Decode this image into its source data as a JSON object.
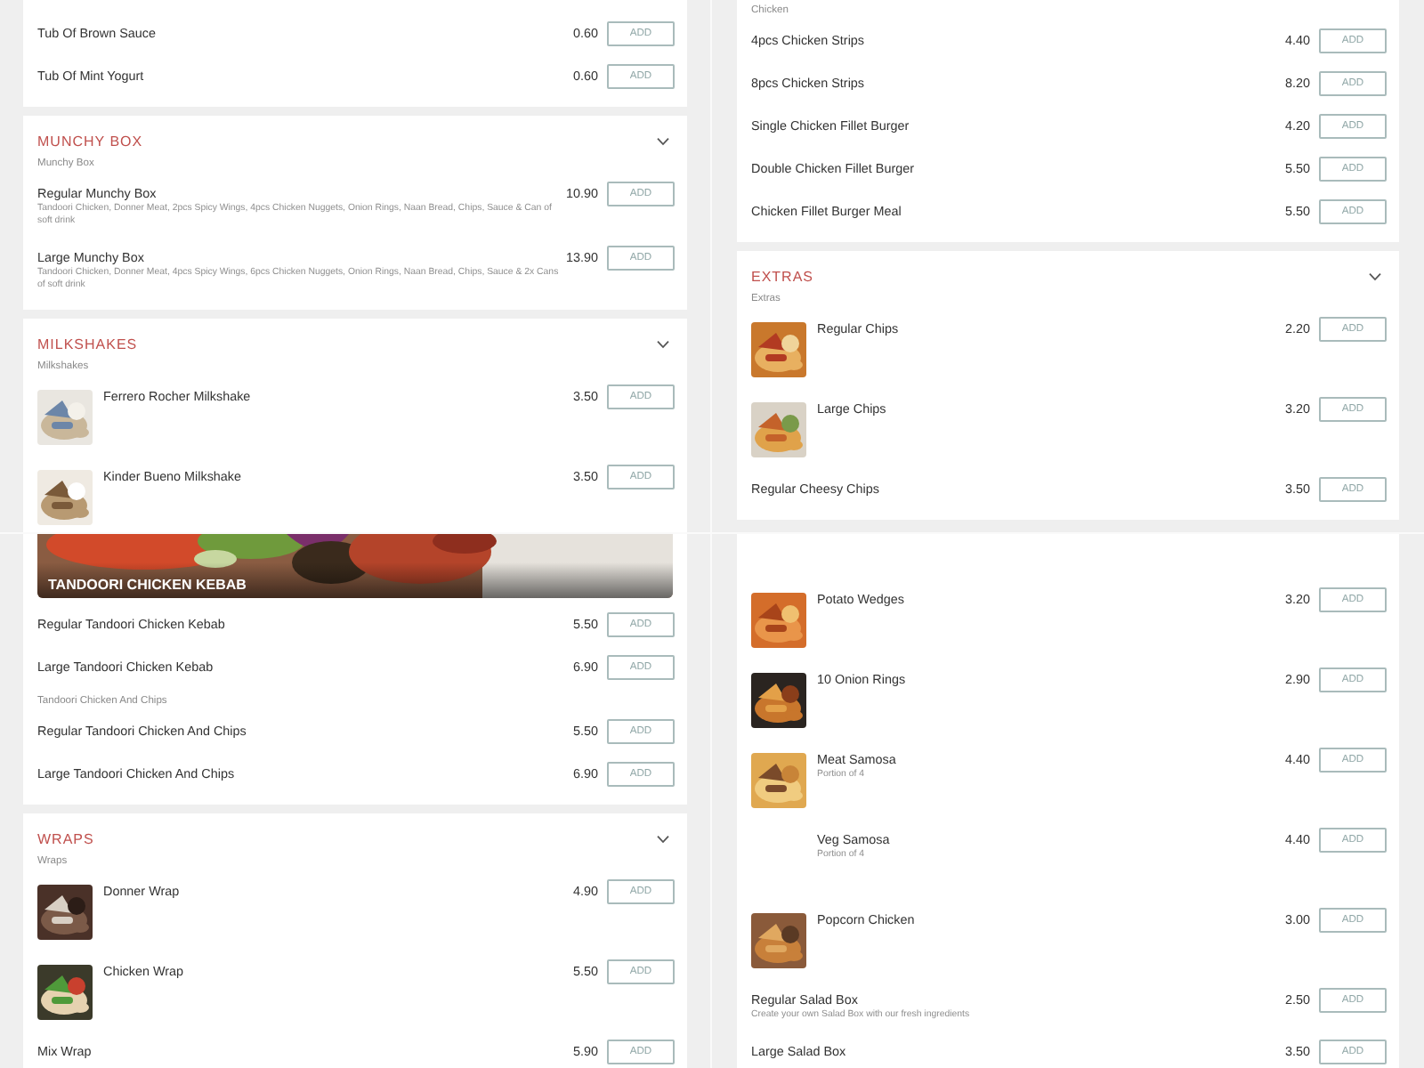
{
  "panels": [
    {
      "cards": [
        {
          "entries": [
            {
              "kind": "item",
              "name": "Tub Of Brown Sauce",
              "price": "0.60",
              "button": "ADD"
            },
            {
              "kind": "item",
              "name": "Tub Of Mint Yogurt",
              "price": "0.60",
              "button": "ADD"
            }
          ]
        },
        {
          "title": "MUNCHY BOX",
          "entries": [
            {
              "kind": "subheading",
              "text": "Munchy Box"
            },
            {
              "kind": "item",
              "name": "Regular Munchy Box",
              "description": "Tandoori Chicken, Donner Meat, 2pcs Spicy Wings, 4pcs Chicken Nuggets, Onion Rings, Naan Bread, Chips, Sauce & Can of soft drink",
              "price": "10.90",
              "button": "ADD"
            },
            {
              "kind": "item",
              "name": "Large Munchy Box",
              "description": "Tandoori Chicken, Donner Meat, 4pcs Spicy Wings, 6pcs Chicken Nuggets, Onion Rings, Naan Bread, Chips, Sauce & 2x Cans of soft drink",
              "price": "13.90",
              "button": "ADD"
            }
          ]
        },
        {
          "title": "MILKSHAKES",
          "entries": [
            {
              "kind": "subheading",
              "text": "Milkshakes"
            },
            {
              "kind": "item",
              "name": "Ferrero Rocher Milkshake",
              "price": "3.50",
              "button": "ADD"
            },
            {
              "kind": "item",
              "name": "Kinder Bueno Milkshake",
              "price": "3.50",
              "button": "ADD"
            }
          ]
        }
      ]
    },
    {
      "cards": [
        {
          "entries": [
            {
              "kind": "banner",
              "title": "TANDOORI CHICKEN KEBAB"
            },
            {
              "kind": "item",
              "name": "Regular Tandoori Chicken Kebab",
              "price": "5.50",
              "button": "ADD"
            },
            {
              "kind": "item",
              "name": "Large Tandoori Chicken Kebab",
              "price": "6.90",
              "button": "ADD"
            },
            {
              "kind": "subheading",
              "text": "Tandoori Chicken And Chips"
            },
            {
              "kind": "item",
              "name": "Regular Tandoori Chicken And Chips",
              "price": "5.50",
              "button": "ADD"
            },
            {
              "kind": "item",
              "name": "Large Tandoori Chicken And Chips",
              "price": "6.90",
              "button": "ADD"
            }
          ]
        },
        {
          "title": "WRAPS",
          "entries": [
            {
              "kind": "subheading",
              "text": "Wraps"
            },
            {
              "kind": "item",
              "name": "Donner Wrap",
              "price": "4.90",
              "button": "ADD"
            },
            {
              "kind": "item",
              "name": "Chicken Wrap",
              "price": "5.50",
              "button": "ADD"
            },
            {
              "kind": "item",
              "name": "Mix Wrap",
              "price": "5.90",
              "button": "ADD"
            }
          ]
        }
      ]
    },
    {
      "cards": [
        {
          "entries": [
            {
              "kind": "subheading",
              "text": "Chicken"
            },
            {
              "kind": "item",
              "name": "4pcs Chicken Strips",
              "price": "4.40",
              "button": "ADD"
            },
            {
              "kind": "item",
              "name": "8pcs Chicken Strips",
              "price": "8.20",
              "button": "ADD"
            },
            {
              "kind": "item",
              "name": "Single Chicken Fillet Burger",
              "price": "4.20",
              "button": "ADD"
            },
            {
              "kind": "item",
              "name": "Double Chicken Fillet Burger",
              "price": "5.50",
              "button": "ADD"
            },
            {
              "kind": "item",
              "name": "Chicken Fillet Burger Meal",
              "price": "5.50",
              "button": "ADD"
            }
          ]
        },
        {
          "title": "EXTRAS",
          "entries": [
            {
              "kind": "subheading",
              "text": "Extras"
            },
            {
              "kind": "item",
              "name": "Regular Chips",
              "price": "2.20",
              "button": "ADD"
            },
            {
              "kind": "item",
              "name": "Large Chips",
              "price": "3.20",
              "button": "ADD"
            },
            {
              "kind": "item",
              "name": "Regular Cheesy Chips",
              "price": "3.50",
              "button": "ADD"
            }
          ]
        }
      ]
    },
    {
      "cards": [
        {
          "entries": [
            {
              "kind": "item",
              "name": "Potato Wedges",
              "price": "3.20",
              "button": "ADD"
            },
            {
              "kind": "item",
              "name": "10 Onion Rings",
              "price": "2.90",
              "button": "ADD"
            },
            {
              "kind": "item",
              "name": "Meat Samosa",
              "description": "Portion of 4",
              "price": "4.40",
              "button": "ADD"
            },
            {
              "kind": "item",
              "name": "Veg Samosa",
              "description": "Portion of 4",
              "price": "4.40",
              "button": "ADD",
              "thumbnail": {
                "kind": "blank"
              }
            },
            {
              "kind": "item",
              "name": "Popcorn Chicken",
              "price": "3.00",
              "button": "ADD"
            },
            {
              "kind": "item",
              "name": "Regular Salad Box",
              "description": "Create your own Salad Box with our fresh ingredients",
              "price": "2.50",
              "button": "ADD"
            },
            {
              "kind": "item",
              "name": "Large Salad Box",
              "price": "3.50",
              "button": "ADD"
            }
          ]
        }
      ]
    }
  ]
}
